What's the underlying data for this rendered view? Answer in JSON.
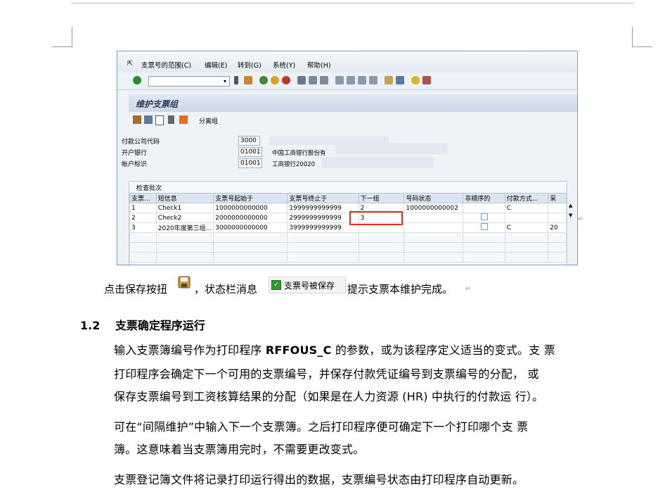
{
  "sap": {
    "menu": [
      "支票号的范围(C)",
      "编辑(E)",
      "转到(G)",
      "系统(Y)",
      "帮助(H)"
    ],
    "title": "维护支票组",
    "app_toolbar_label": "分离组",
    "fields": [
      {
        "label": "付款公司代码",
        "value": "3000",
        "desc": ""
      },
      {
        "label": "开户银行",
        "value": "01001",
        "desc": "中国工商银行股份有"
      },
      {
        "label": "帐户标识",
        "value": "01001",
        "desc": "工商银行20020"
      }
    ],
    "group_title": "检查批次",
    "columns": [
      "支票...",
      "短信息",
      "支票号起始于",
      "支票号终止于",
      "下一组",
      "号码状态",
      "非顺序的",
      "付款方式...",
      "采"
    ],
    "rows": [
      {
        "c1": "1",
        "c2": "Check1",
        "c3": "1000000000000",
        "c4": "1999999999999",
        "c5": "2",
        "c6": "1000000000002",
        "c7": "",
        "c8": "C",
        "c9": ""
      },
      {
        "c1": "2",
        "c2": "Check2",
        "c3": "2000000000000",
        "c4": "2999999999999",
        "c5": "3",
        "c6": "",
        "c7": "",
        "c8": "",
        "c9": ""
      },
      {
        "c1": "3",
        "c2": "2020年度第三组...",
        "c3": "3000000000000",
        "c4": "3999999999999",
        "c5": "",
        "c6": "",
        "c7": "",
        "c8": "C",
        "c9": "20"
      }
    ]
  },
  "doc": {
    "line1_a": "点击保存按扭",
    "line1_b": "，状态栏消息",
    "status_msg": "支票号被保存",
    "line1_c": "提示支票本维护完成。",
    "heading_num": "1.2",
    "heading_text": "支票确定程序运行",
    "p1_l1a": "输入支票簿编号作为打印程序 ",
    "p1_l1b": "RFFOUS_C",
    "p1_l1c": " 的参数，或为该程序定义适当的变式。支 票",
    "p1_l2": "打印程序会确定下一个可用的支票编号，并保存付款凭证编号到支票编号的分配， 或",
    "p1_l3": "保存支票编号到工资核算结果的分配（如果是在人力资源 (HR) 中执行的付款运 行）。",
    "p2_l1": "可在“间隔维护”中输入下一个支票簿。之后打印程序便可确定下一个打印哪个支 票",
    "p2_l2": "簿。这意味着当支票簿用完时，不需要更改变式。",
    "p3_l1": "支票登记簿文件将记录打印运行得出的数据，支票编号状态由打印程序自动更新。"
  },
  "colors": {
    "accent_red": "#e0301e",
    "sap_title_bg": "#c9d8e7",
    "status_green": "#2f9a2f"
  }
}
